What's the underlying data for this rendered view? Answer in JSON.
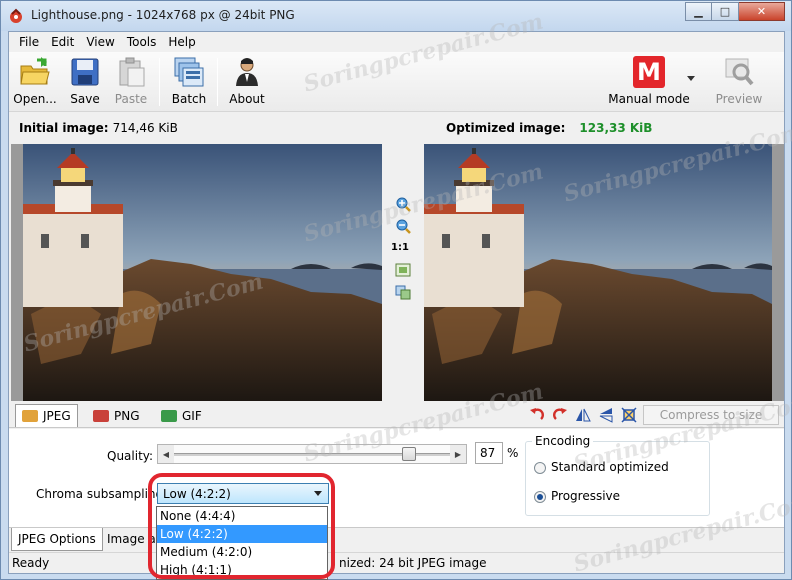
{
  "window": {
    "title": "Lighthouse.png - 1024x768 px @ 24bit PNG",
    "minimize": "▁",
    "maximize": "□",
    "close": "✕"
  },
  "menu": {
    "items": [
      {
        "label": "File"
      },
      {
        "label": "Edit"
      },
      {
        "label": "View"
      },
      {
        "label": "Tools"
      },
      {
        "label": "Help"
      }
    ]
  },
  "toolbar": {
    "open_label": "Open...",
    "save_label": "Save",
    "paste_label": "Paste",
    "batch_label": "Batch",
    "about_label": "About",
    "mode_label": "Manual mode",
    "mode_letter": "M",
    "preview_label": "Preview"
  },
  "sizes": {
    "initial_label": "Initial image:",
    "initial_value": "714,46 KiB",
    "optimized_label": "Optimized image:",
    "optimized_value": "123,33 KiB"
  },
  "midtools": {
    "one_to_one": "1:1"
  },
  "format_tabs": [
    {
      "label": "JPEG",
      "active": true
    },
    {
      "label": "PNG",
      "active": false
    },
    {
      "label": "GIF",
      "active": false
    }
  ],
  "compress_label": "Compress to size",
  "options": {
    "quality_label": "Quality:",
    "quality_value": "87",
    "quality_fraction": 0.87,
    "quality_unit": "%",
    "chroma_label": "Chroma subsampling:",
    "chroma_selected": "Low (4:2:2)",
    "chroma_options": [
      {
        "label": "None (4:4:4)",
        "selected": false
      },
      {
        "label": "Low (4:2:2)",
        "selected": true
      },
      {
        "label": "Medium (4:2:0)",
        "selected": false
      },
      {
        "label": "High (4:1:1)",
        "selected": false
      }
    ],
    "encoding_label": "Encoding",
    "encoding_standard": "Standard optimized",
    "encoding_progressive": "Progressive"
  },
  "bottom_tabs": [
    {
      "label": "JPEG Options",
      "active": true
    },
    {
      "label": "Image ad",
      "active": false
    }
  ],
  "status": {
    "ready": "Ready",
    "message": "nized: 24 bit JPEG image"
  },
  "watermark": "Soringpcrepair.Com",
  "colors": {
    "optimized_value": "#1d8f2a",
    "highlight": "#e1262f",
    "mode_badge": "#e3262b"
  }
}
